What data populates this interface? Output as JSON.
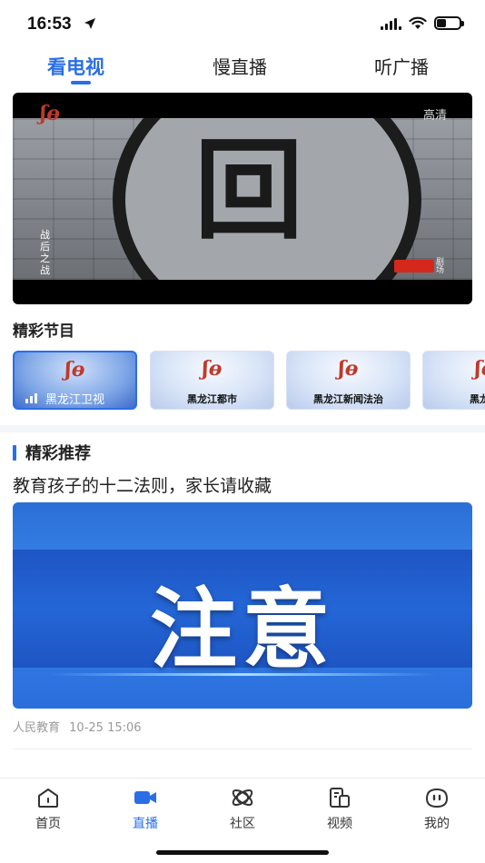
{
  "status_bar": {
    "time": "16:53",
    "battery_level": 0.4
  },
  "top_tabs": [
    {
      "label": "看电视",
      "active": true
    },
    {
      "label": "慢直播",
      "active": false
    },
    {
      "label": "听广播",
      "active": false
    }
  ],
  "player": {
    "logo": "ʃɵ",
    "hd_label": "高清",
    "vertical_title": "战后之战",
    "side_label": "剧场"
  },
  "programs": {
    "title": "精彩节目",
    "channels": [
      {
        "name": "黑龙江卫视",
        "active": true
      },
      {
        "name": "黑龙江都市",
        "active": false
      },
      {
        "name": "黑龙江新闻法治",
        "active": false
      },
      {
        "name": "黑龙江",
        "active": false
      }
    ]
  },
  "recommend": {
    "title": "精彩推荐",
    "article": {
      "title": "教育孩子的十二法则，家长请收藏",
      "image_text": "注意",
      "source": "人民教育",
      "date": "10-25 15:06"
    }
  },
  "bottom_nav": [
    {
      "label": "首页",
      "icon": "home-icon",
      "active": false
    },
    {
      "label": "直播",
      "icon": "video-camera-icon",
      "active": true
    },
    {
      "label": "社区",
      "icon": "planet-icon",
      "active": false
    },
    {
      "label": "视频",
      "icon": "video-list-icon",
      "active": false
    },
    {
      "label": "我的",
      "icon": "face-icon",
      "active": false
    }
  ],
  "colors": {
    "accent": "#2a6ee8",
    "logo_red": "#c0392b"
  }
}
